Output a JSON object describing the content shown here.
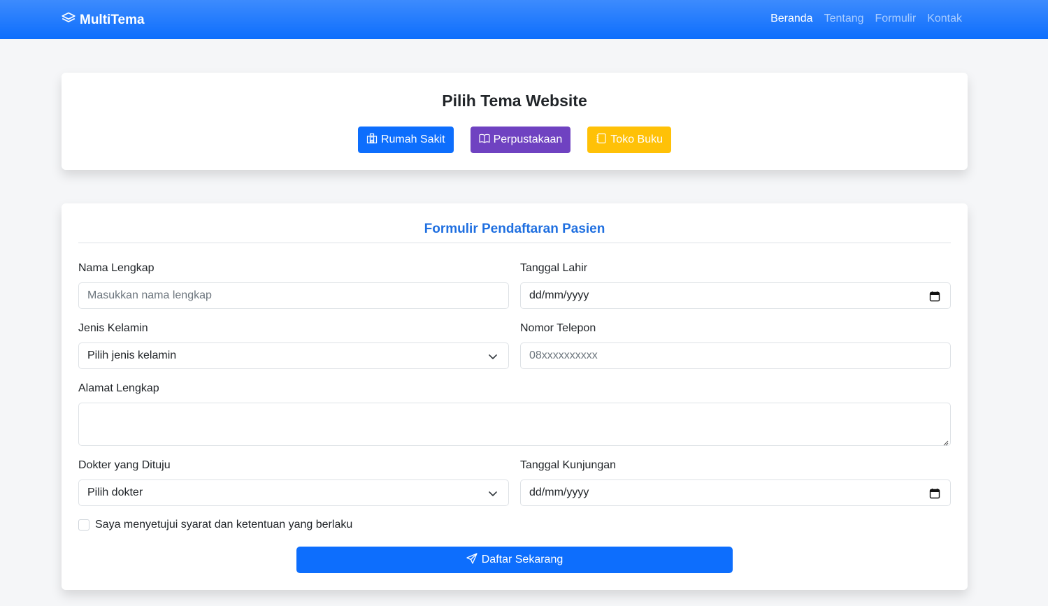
{
  "navbar": {
    "brand": "MultiTema",
    "links": [
      {
        "label": "Beranda",
        "active": true
      },
      {
        "label": "Tentang",
        "active": false
      },
      {
        "label": "Formulir",
        "active": false
      },
      {
        "label": "Kontak",
        "active": false
      }
    ]
  },
  "theme_selector": {
    "title": "Pilih Tema Website",
    "buttons": [
      {
        "label": "Rumah Sakit",
        "icon": "hospital-icon",
        "color": "#0d6efd"
      },
      {
        "label": "Perpustakaan",
        "icon": "book-icon",
        "color": "#6f42c1"
      },
      {
        "label": "Toko Buku",
        "icon": "journal-icon",
        "color": "#ffc107"
      }
    ]
  },
  "form": {
    "title": "Formulir Pendaftaran Pasien",
    "fields": {
      "nama": {
        "label": "Nama Lengkap",
        "placeholder": "Masukkan nama lengkap"
      },
      "tanggal_lahir": {
        "label": "Tanggal Lahir",
        "value": "dd/mm/yyyy"
      },
      "jenis_kelamin": {
        "label": "Jenis Kelamin",
        "selected": "Pilih jenis kelamin"
      },
      "telepon": {
        "label": "Nomor Telepon",
        "placeholder": "08xxxxxxxxxx"
      },
      "alamat": {
        "label": "Alamat Lengkap",
        "value": ""
      },
      "dokter": {
        "label": "Dokter yang Dituju",
        "selected": "Pilih dokter"
      },
      "tanggal_kunjungan": {
        "label": "Tanggal Kunjungan",
        "value": "dd/mm/yyyy"
      }
    },
    "agreement": "Saya menyetujui syarat dan ketentuan yang berlaku",
    "submit_label": "Daftar Sekarang"
  },
  "colors": {
    "primary": "#0d6efd",
    "purple": "#6f42c1",
    "warning": "#ffc107",
    "form_title": "#1f6fe0"
  }
}
